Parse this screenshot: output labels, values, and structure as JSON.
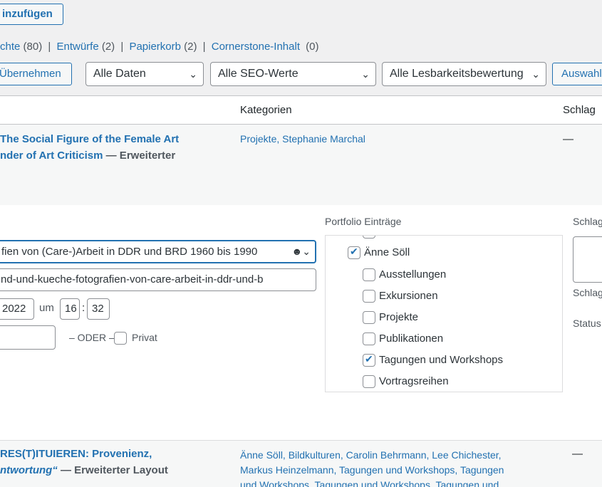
{
  "top_button": "inzufügen",
  "subsubsub": {
    "visible_prefix": "chte",
    "visible_count": "(80)",
    "sep": "|",
    "drafts": "Entwürfe",
    "drafts_count": "(2)",
    "trash": "Papierkorb",
    "trash_count": "(2)",
    "cornerstone": "Cornerstone-Inhalt",
    "cornerstone_count": "(0)"
  },
  "filters": {
    "apply": "Übernehmen",
    "dates": "Alle Daten",
    "seo": "Alle SEO-Werte",
    "readability": "Alle Lesbarkeitsbewertung",
    "filter_button": "Auswahl"
  },
  "table": {
    "col_categories": "Kategorien",
    "col_tags": "Schlag"
  },
  "row1": {
    "title_line1": "The Social Figure of the Female Art",
    "title_line2": "nder of Art Criticism",
    "suffix": "— Erweiterter",
    "categories_a": "Projekte",
    "categories_b": "Stephanie Marchal",
    "tags": "—"
  },
  "quick_edit": {
    "title_value": "fien von (Care-)Arbeit in DDR und BRD 1960 bis 1990",
    "slug_value": "nd-und-kueche-fotografien-von-care-arbeit-in-ddr-und-b",
    "year": "2022",
    "at": "um",
    "hour": "16",
    "colon": ":",
    "minute": "32",
    "or": "– ODER –",
    "private": "Privat",
    "portfolio_label": "Portfolio Einträge",
    "tags_label": "Schlag",
    "tags_label2": "Schlag",
    "status_label": "Status",
    "parent_item": "Änne Söll",
    "children": [
      {
        "label": "Ausstellungen",
        "checked": false
      },
      {
        "label": "Exkursionen",
        "checked": false
      },
      {
        "label": "Projekte",
        "checked": false
      },
      {
        "label": "Publikationen",
        "checked": false
      },
      {
        "label": "Tagungen und Workshops",
        "checked": true
      },
      {
        "label": "Vortragsreihen",
        "checked": false
      }
    ]
  },
  "row2": {
    "title_line1": "RES(T)ITUIEREN: Provenienz,",
    "title_line2": "ntwortung“",
    "suffix": "— Erweiterter Layout",
    "cat_line1": "Änne Söll, Bildkulturen, Carolin Behrmann, Lee Chichester,",
    "cat_line2": "Markus Heinzelmann, Tagungen und Workshops, Tagungen",
    "cat_line3": "und Workshops, Tagungen und Workshops, Tagungen und",
    "tags": "—"
  }
}
